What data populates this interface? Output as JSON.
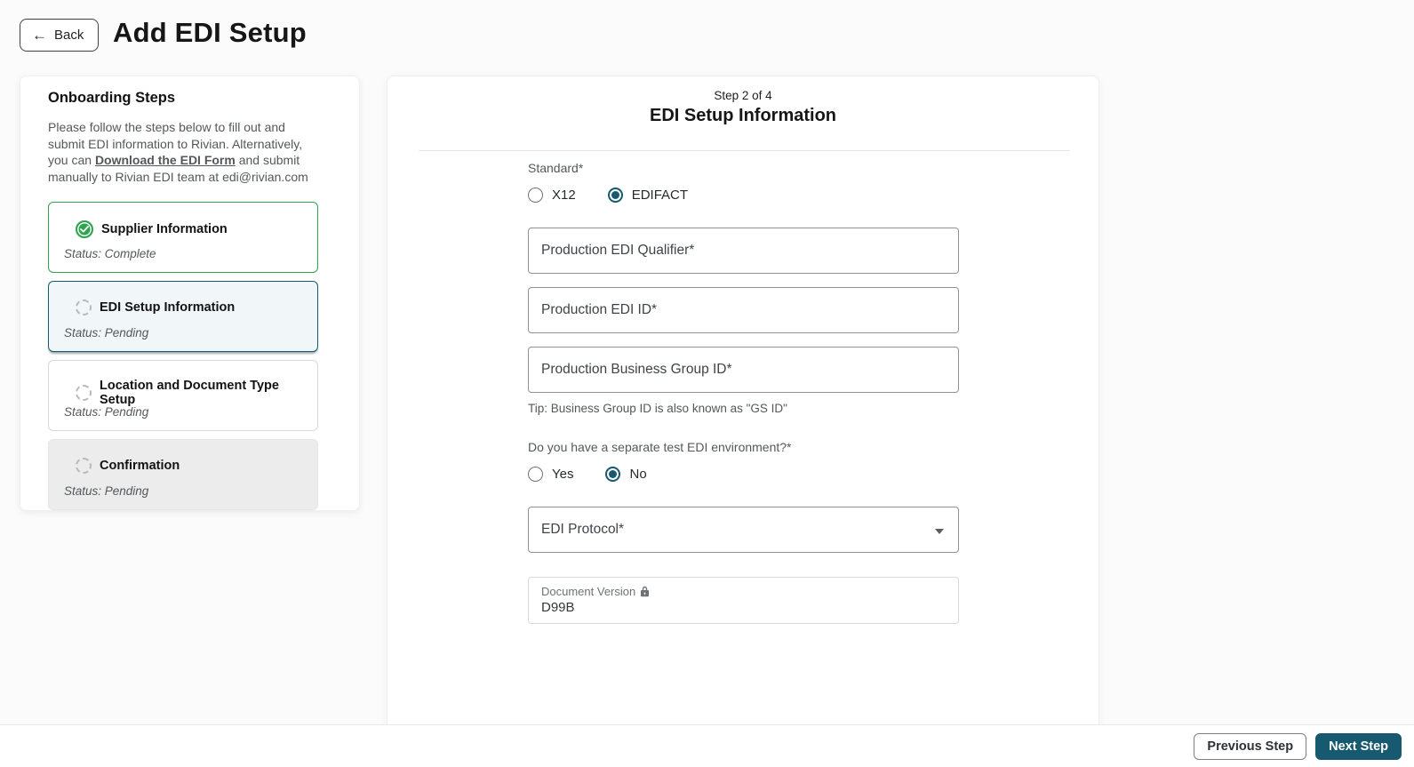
{
  "header": {
    "back_label": "Back",
    "title": "Add EDI Setup"
  },
  "sidebar": {
    "title": "Onboarding Steps",
    "description_before_link": "Please follow the steps below to fill out and submit EDI information to Rivian. Alternatively, you can ",
    "link_text": "Download the EDI Form",
    "description_after_link": " and submit manually to Rivian EDI team at edi@rivian.com",
    "steps": [
      {
        "label": "Supplier Information",
        "status": "Status: Complete",
        "state": "complete"
      },
      {
        "label": "EDI Setup Information",
        "status": "Status: Pending",
        "state": "active"
      },
      {
        "label": "Location and Document Type Setup",
        "status": "Status: Pending",
        "state": "pending"
      },
      {
        "label": "Confirmation",
        "status": "Status: Pending",
        "state": "disabled"
      }
    ]
  },
  "main": {
    "step_indicator": "Step 2 of 4",
    "title": "EDI Setup Information",
    "standard_label": "Standard*",
    "standard_options": [
      {
        "label": "X12",
        "selected": false
      },
      {
        "label": "EDIFACT",
        "selected": true
      }
    ],
    "fields": {
      "production_edi_qualifier": {
        "placeholder": "Production EDI Qualifier*",
        "value": ""
      },
      "production_edi_id": {
        "placeholder": "Production EDI ID*",
        "value": ""
      },
      "production_business_group_id": {
        "placeholder": "Production Business Group ID*",
        "value": ""
      }
    },
    "tip": "Tip: Business Group ID is also known as \"GS ID\"",
    "test_env_question": "Do you have a separate test EDI environment?*",
    "test_env_options": [
      {
        "label": "Yes",
        "selected": false
      },
      {
        "label": "No",
        "selected": true
      }
    ],
    "edi_protocol": {
      "label": "EDI Protocol*"
    },
    "document_version": {
      "label": "Document Version",
      "value": "D99B",
      "locked": true
    }
  },
  "footer": {
    "previous_label": "Previous Step",
    "next_label": "Next Step"
  },
  "colors": {
    "accent_teal": "#17596F",
    "success_green": "#2DA44E",
    "active_step_bg": "#F1F7F9"
  }
}
